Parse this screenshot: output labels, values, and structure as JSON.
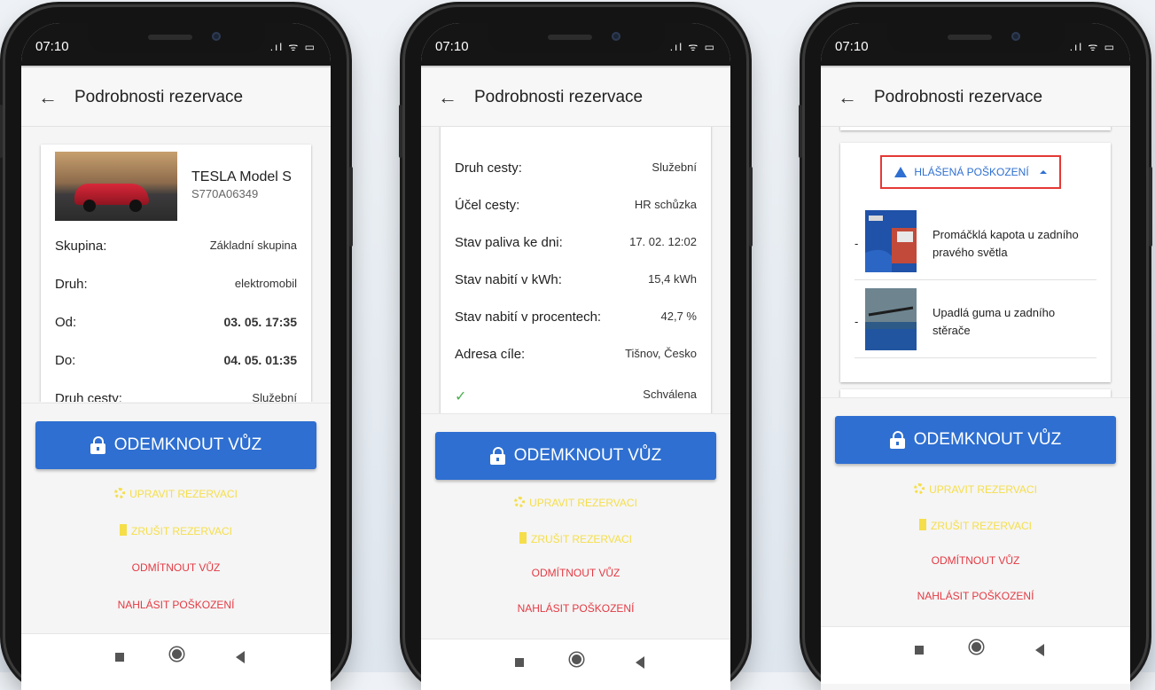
{
  "screens": [
    {
      "status": {
        "time": "07:10",
        "icons": ".ıl ᯤ ▭"
      },
      "appbar": {
        "back_icon": "←",
        "title": "Podrobnosti rezervace"
      },
      "car": {
        "name": "TESLA Model S",
        "plate": "S770A06349"
      },
      "rows": [
        {
          "label": "Skupina:",
          "value": "Základní skupina"
        },
        {
          "label": "Druh:",
          "value": "elektromobil"
        },
        {
          "label": "Od:",
          "value": "03. 05. 17:35"
        },
        {
          "label": "Do:",
          "value": "04. 05. 01:35"
        },
        {
          "label": "Druh cesty:",
          "value": "Služební"
        }
      ],
      "actions": {
        "unlock": "ODEMKNOUT VŮZ",
        "edit": "UPRAVIT REZERVACI",
        "cancel": "ZRUŠIT REZERVACI",
        "reject": "ODMÍTNOUT VŮZ",
        "report": "NAHLÁSIT POŠKOZENÍ"
      }
    },
    {
      "status": {
        "time": "07:10",
        "icons": ".ıl ᯤ ▭"
      },
      "appbar": {
        "back_icon": "←",
        "title": "Podrobnosti rezervace"
      },
      "rows": [
        {
          "label": "Druh cesty:",
          "value": "Služební"
        },
        {
          "label": "Účel cesty:",
          "value": "HR schůzka"
        },
        {
          "label": "Stav paliva ke dni:",
          "value": "17. 02. 12:02"
        },
        {
          "label": "Stav nabití v kWh:",
          "value": "15,4 kWh"
        },
        {
          "label": "Stav nabití v procentech:",
          "value": "42,7 %"
        },
        {
          "label": "Adresa cíle:",
          "value": "Tišnov, Česko"
        }
      ],
      "approval": {
        "check_icon": "✓",
        "status": "Schválena"
      },
      "actions": {
        "unlock": "ODEMKNOUT VŮZ",
        "edit": "UPRAVIT REZERVACI",
        "cancel": "ZRUŠIT REZERVACI",
        "reject": "ODMÍTNOUT VŮZ",
        "report": "NAHLÁSIT POŠKOZENÍ"
      }
    },
    {
      "status": {
        "time": "07:10",
        "icons": ".ıl ᯤ ▭"
      },
      "appbar": {
        "back_icon": "←",
        "title": "Podrobnosti rezervace"
      },
      "damages": {
        "header": "HLÁŠENÁ POŠKOZENÍ",
        "items": [
          {
            "bullet": "-",
            "text": "Promáčklá kapota u zadního pravého světla"
          },
          {
            "bullet": "-",
            "text": "Upadlá guma u zadního stěrače"
          }
        ]
      },
      "actions": {
        "unlock": "ODEMKNOUT VŮZ",
        "edit": "UPRAVIT REZERVACI",
        "cancel": "ZRUŠIT REZERVACI",
        "reject": "ODMÍTNOUT VŮZ",
        "report": "NAHLÁSIT POŠKOZENÍ"
      }
    }
  ]
}
